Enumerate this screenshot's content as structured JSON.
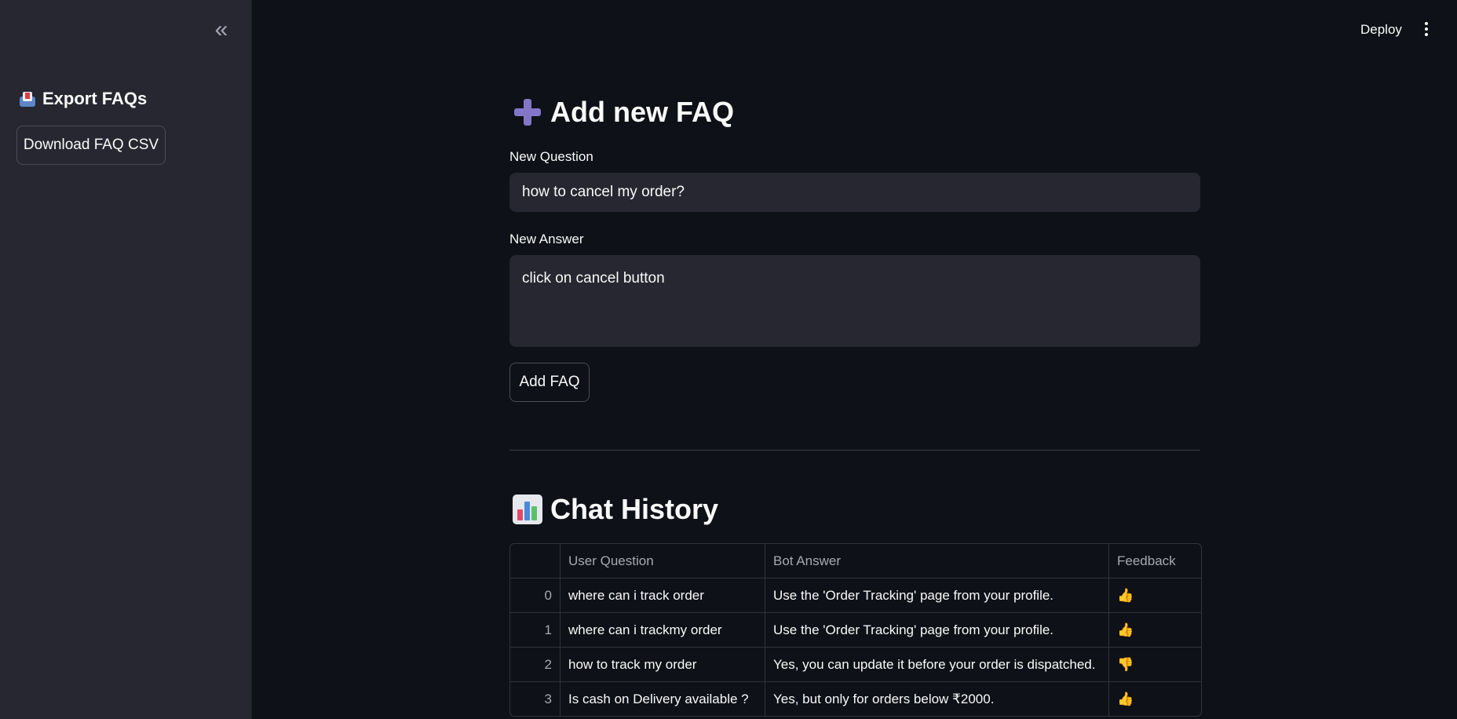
{
  "header": {
    "deploy_label": "Deploy"
  },
  "sidebar": {
    "collapse_glyph": "«",
    "title": "Export FAQs",
    "title_icon": "inbox-tray-icon",
    "download_label": "Download FAQ CSV"
  },
  "add_faq": {
    "title": "Add new FAQ",
    "question_label": "New Question",
    "question_value": "how to cancel my order?",
    "answer_label": "New Answer",
    "answer_value": "click on cancel button",
    "button_label": "Add FAQ"
  },
  "history": {
    "title": "Chat History",
    "columns": [
      "",
      "User Question",
      "Bot Answer",
      "Feedback"
    ],
    "rows": [
      {
        "index": "0",
        "question": "where can i track order",
        "answer": "Use the 'Order Tracking' page from your profile.",
        "feedback": "👍"
      },
      {
        "index": "1",
        "question": "where can i trackmy order",
        "answer": "Use the 'Order Tracking' page from your profile.",
        "feedback": "👍"
      },
      {
        "index": "2",
        "question": "how to track my order",
        "answer": "Yes, you can update it before your order is dispatched.",
        "feedback": "👎"
      },
      {
        "index": "3",
        "question": "Is cash on Delivery available ?",
        "answer": "Yes, but only for orders below ₹2000.",
        "feedback": "👍"
      }
    ]
  },
  "colors": {
    "background": "#0e1117",
    "sidebar": "#262730",
    "input": "#262730",
    "accent_plus": "#8476c7"
  }
}
